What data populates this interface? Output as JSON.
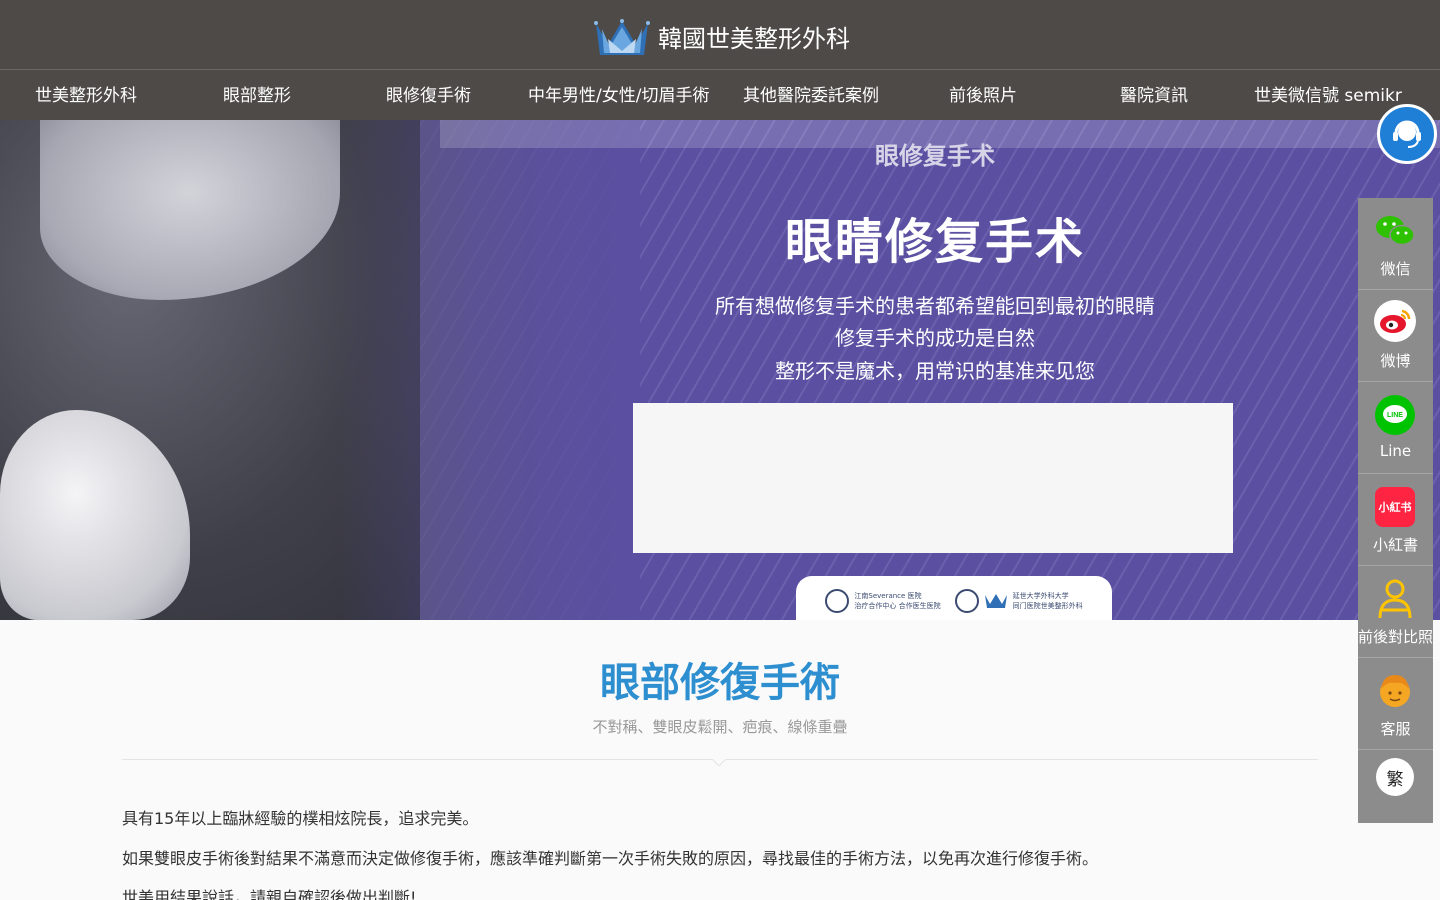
{
  "header": {
    "logo_text": "韓國世美整形外科",
    "brand_color": "#4d4a48"
  },
  "nav": {
    "items": [
      {
        "label": "世美整形外科"
      },
      {
        "label": "眼部整形"
      },
      {
        "label": "眼修復手術"
      },
      {
        "label": "中年男性/女性/切眉手術"
      },
      {
        "label": "其他醫院委託案例"
      },
      {
        "label": "前後照片"
      },
      {
        "label": "醫院資訊"
      },
      {
        "label": "世美微信號 semikr"
      }
    ]
  },
  "hero": {
    "subtitle": "眼修复手术",
    "title": "眼睛修复手术",
    "lines": [
      "所有想做修复手术的患者都希望能回到最初的眼睛",
      "修复手术的成功是自然",
      "整形不是魔术，用常识的基准来见您"
    ],
    "badge": {
      "left_line1": "江南Severance 医院",
      "left_line2": "治疗合作中心 合作医生医院",
      "right_line1": "延世大学外科大学",
      "right_line2": "同门医院世美整形外科"
    },
    "accent_color": "#5a4fa0"
  },
  "main": {
    "title": "眼部修復手術",
    "subtitle": "不對稱、雙眼皮鬆開、疤痕、線條重疊",
    "title_color": "#2e8fd0",
    "paragraphs": [
      "具有15年以上臨牀經驗的樸相炫院長，追求完美。",
      "如果雙眼皮手術後對結果不滿意而決定做修復手術，應該準確判斷第一次手術失敗的原因，尋找最佳的手術方法，以免再次進行修復手術。",
      "世美用結果說話，請親自確認後做出判斷!"
    ]
  },
  "sidebar": {
    "items": [
      {
        "label": "微信",
        "icon": "wechat-icon"
      },
      {
        "label": "微博",
        "icon": "weibo-icon"
      },
      {
        "label": "Line",
        "icon": "line-icon"
      },
      {
        "label": "小紅書",
        "icon": "xiaohongshu-icon",
        "icon_text": "小紅书"
      },
      {
        "label": "前後對比照",
        "icon": "person-icon"
      },
      {
        "label": "客服",
        "icon": "service-icon"
      }
    ],
    "lang_toggle": "繁"
  }
}
